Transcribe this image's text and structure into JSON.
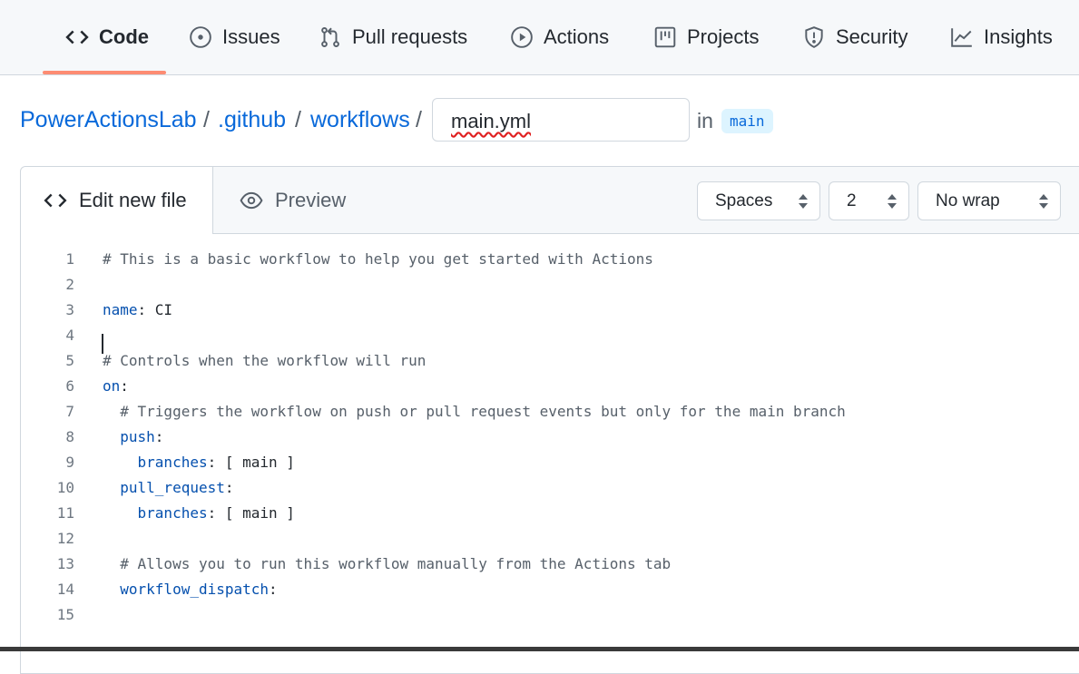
{
  "nav": {
    "tabs": [
      {
        "label": "Code",
        "icon": "code-icon"
      },
      {
        "label": "Issues",
        "icon": "issue-opened-icon"
      },
      {
        "label": "Pull requests",
        "icon": "git-pull-request-icon"
      },
      {
        "label": "Actions",
        "icon": "play-icon"
      },
      {
        "label": "Projects",
        "icon": "table-icon"
      },
      {
        "label": "Security",
        "icon": "shield-icon"
      },
      {
        "label": "Insights",
        "icon": "graph-icon"
      }
    ],
    "active_tab": "Code"
  },
  "breadcrumb": {
    "items": [
      "PowerActionsLab",
      ".github",
      "workflows"
    ],
    "separator": "/",
    "filename_value": "main.yml",
    "in_label": "in",
    "branch": "main"
  },
  "editor": {
    "tabs": [
      {
        "label": "Edit new file",
        "icon": "code-icon"
      },
      {
        "label": "Preview",
        "icon": "eye-icon"
      }
    ],
    "indent_mode": "Spaces",
    "indent_size": "2",
    "wrap_mode": "No wrap",
    "lines": [
      {
        "n": "1",
        "text": "# This is a basic workflow to help you get started with Actions"
      },
      {
        "n": "2",
        "text": ""
      },
      {
        "n": "3",
        "key": "name",
        "text": ": CI"
      },
      {
        "n": "4",
        "text": ""
      },
      {
        "n": "5",
        "text": "# Controls when the workflow will run"
      },
      {
        "n": "6",
        "key": "on",
        "text": ":"
      },
      {
        "n": "7",
        "text": "  # Triggers the workflow on push or pull request events but only for the main branch"
      },
      {
        "n": "8",
        "indent": "  ",
        "key": "push",
        "text": ":"
      },
      {
        "n": "9",
        "indent": "    ",
        "key": "branches",
        "text": ": [ main ]"
      },
      {
        "n": "10",
        "indent": "  ",
        "key": "pull_request",
        "text": ":"
      },
      {
        "n": "11",
        "indent": "    ",
        "key": "branches",
        "text": ": [ main ]"
      },
      {
        "n": "12",
        "text": ""
      },
      {
        "n": "13",
        "text": "  # Allows you to run this workflow manually from the Actions tab"
      },
      {
        "n": "14",
        "indent": "  ",
        "key": "workflow_dispatch",
        "text": ":"
      },
      {
        "n": "15",
        "text": ""
      }
    ]
  }
}
